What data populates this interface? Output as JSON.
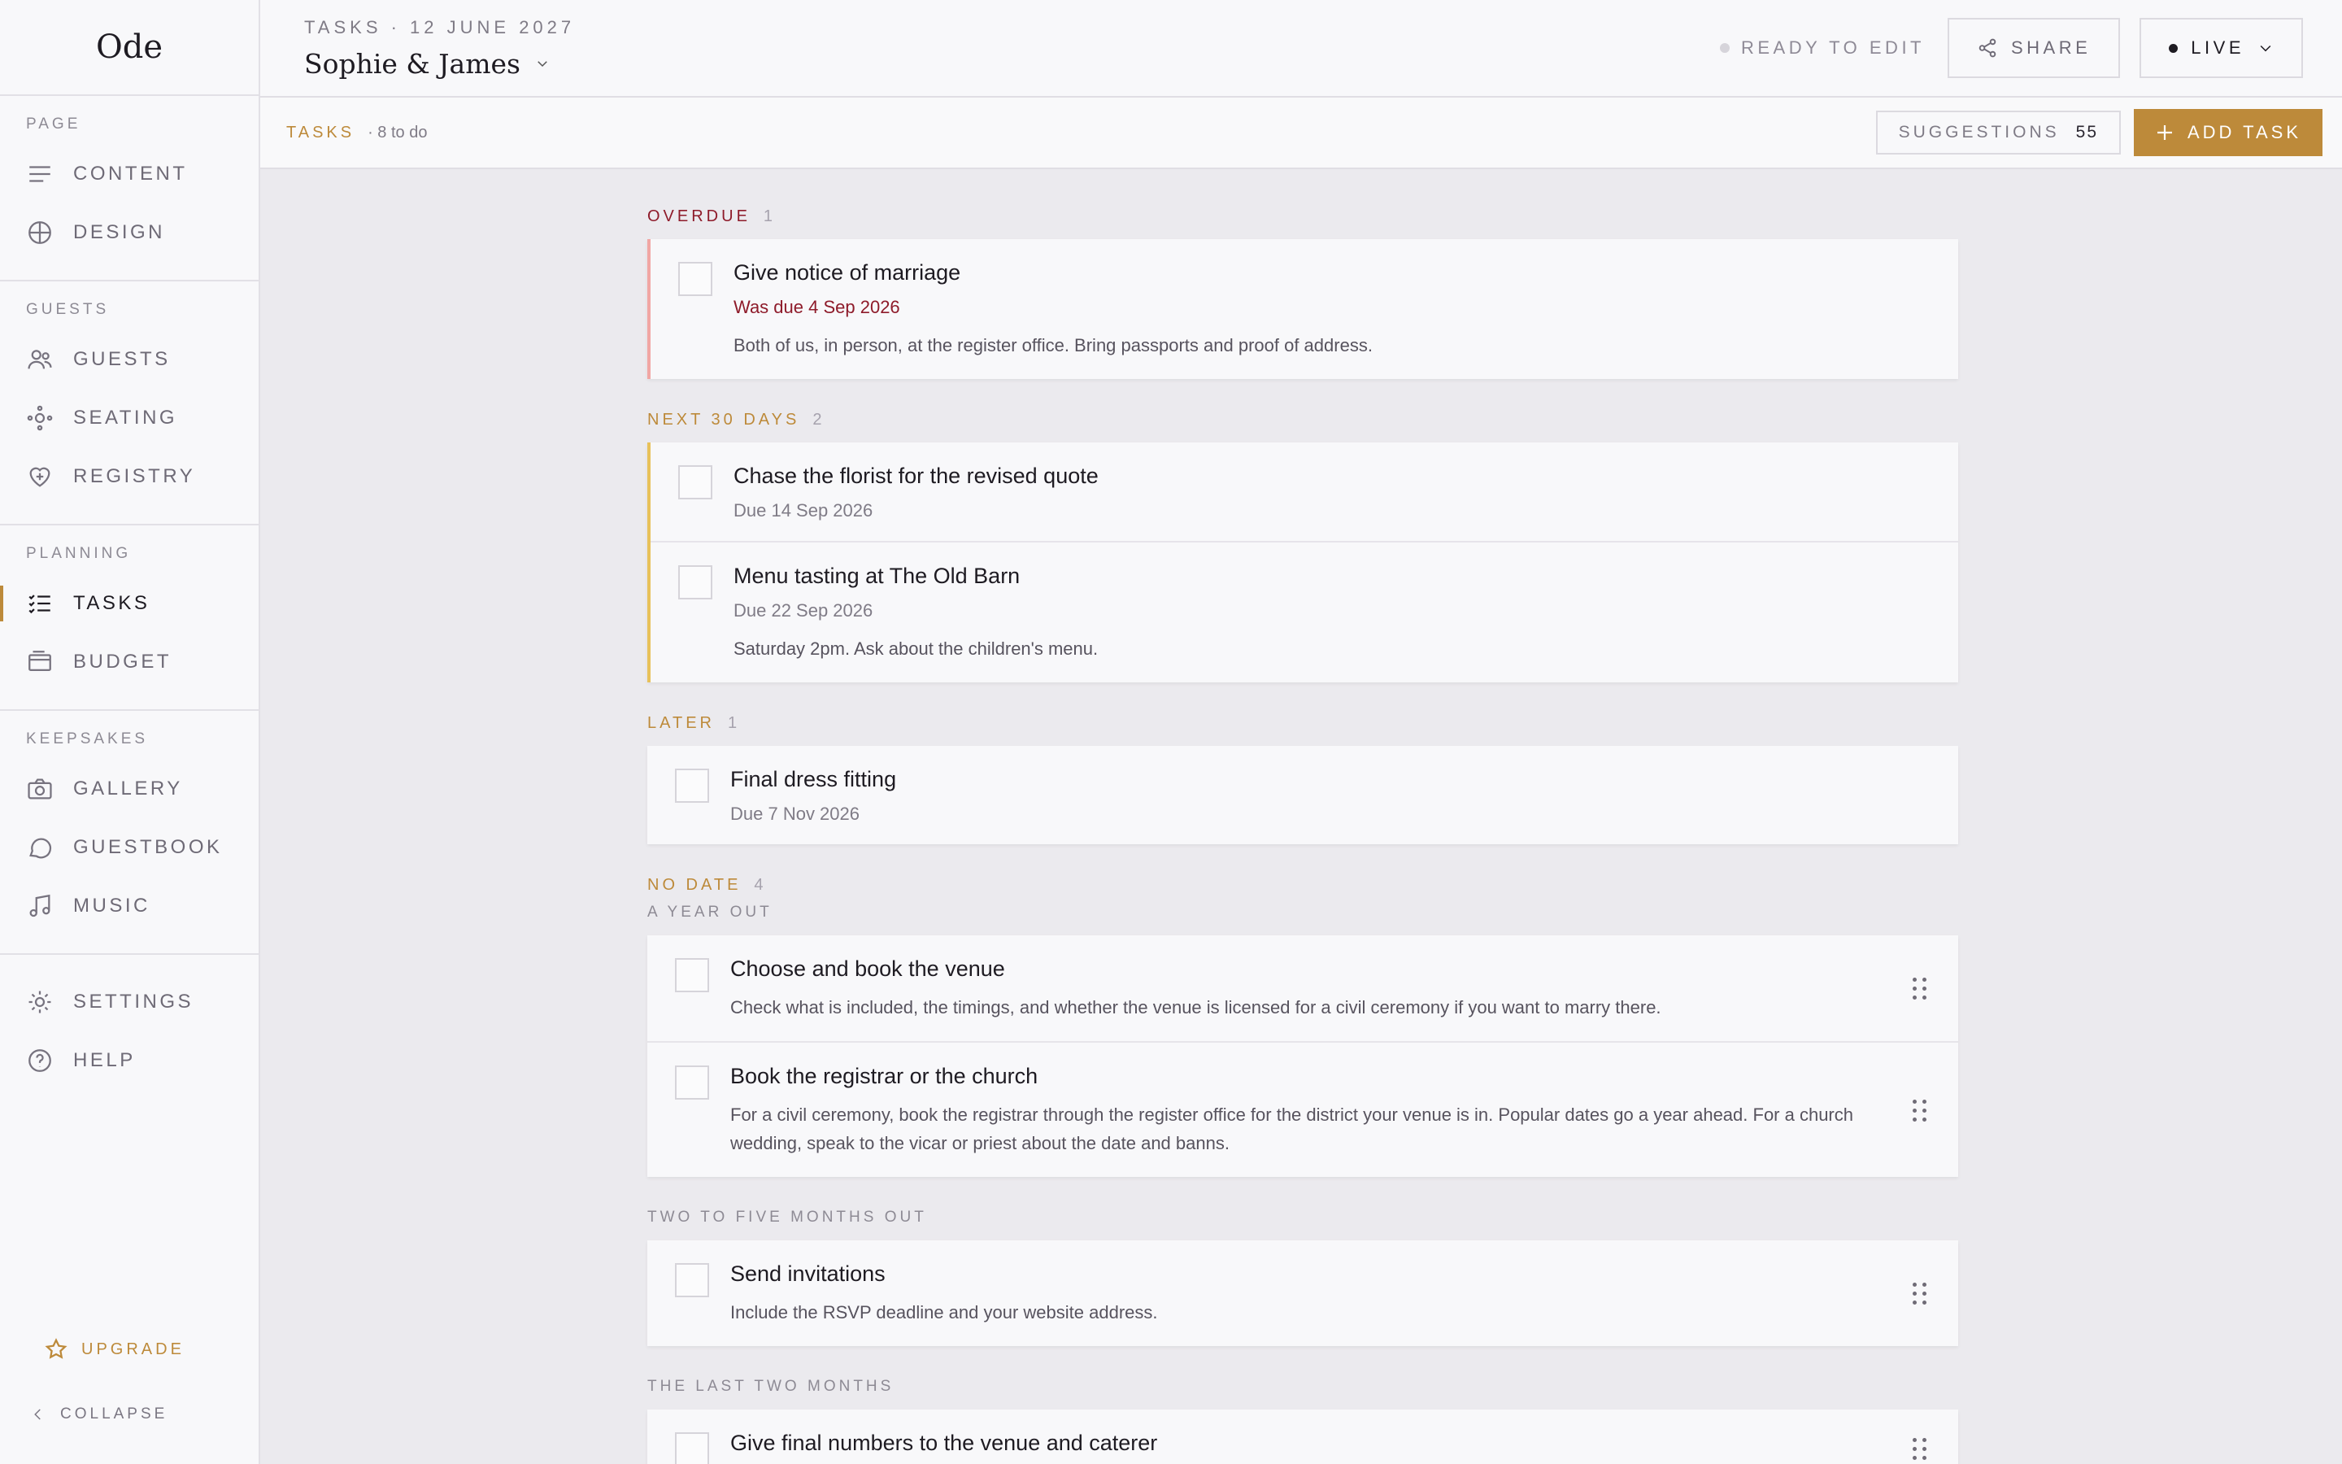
{
  "sidebar": {
    "logo": "Ode",
    "groups": [
      {
        "label": "Page",
        "items": [
          {
            "label": "Content"
          },
          {
            "label": "Design"
          }
        ]
      },
      {
        "label": "Guests",
        "items": [
          {
            "label": "Guests"
          },
          {
            "label": "Seating"
          },
          {
            "label": "Registry"
          }
        ]
      },
      {
        "label": "Planning",
        "items": [
          {
            "label": "Tasks"
          },
          {
            "label": "Budget"
          }
        ]
      },
      {
        "label": "Keepsakes",
        "items": [
          {
            "label": "Gallery"
          },
          {
            "label": "Guestbook"
          },
          {
            "label": "Music"
          }
        ]
      }
    ],
    "settings": "Settings",
    "help": "Help",
    "upgrade": "Upgrade",
    "collapse": "Collapse"
  },
  "header": {
    "breadcrumb": "TASKS · 12 JUNE 2027",
    "site_name": "Sophie & James",
    "status": "READY TO EDIT",
    "share": "SHARE",
    "live": "LIVE"
  },
  "subbar": {
    "title": "Tasks",
    "count": "· 8 to do",
    "suggestions_label": "Suggestions",
    "suggestions_count": "55",
    "add_task": "Add task"
  },
  "sections": {
    "overdue": {
      "label": "Overdue",
      "count": "1",
      "tasks": [
        {
          "title": "Give notice of marriage",
          "due": "Was due 4 Sep 2026",
          "note": "Both of us, in person, at the register office. Bring passports and proof of address."
        }
      ]
    },
    "next30": {
      "label": "Next 30 days",
      "count": "2",
      "tasks": [
        {
          "title": "Chase the florist for the revised quote",
          "due": "Due 14 Sep 2026"
        },
        {
          "title": "Menu tasting at The Old Barn",
          "due": "Due 22 Sep 2026",
          "note": "Saturday 2pm. Ask about the children's menu."
        }
      ]
    },
    "later": {
      "label": "Later",
      "count": "1",
      "tasks": [
        {
          "title": "Final dress fitting",
          "due": "Due 7 Nov 2026"
        }
      ]
    },
    "nodate": {
      "label": "No date",
      "count": "4",
      "year_out": {
        "label": "A year out",
        "tasks": [
          {
            "title": "Choose and book the venue",
            "note": "Check what is included, the timings, and whether the venue is licensed for a civil ceremony if you want to marry there."
          },
          {
            "title": "Book the registrar or the church",
            "note": "For a civil ceremony, book the registrar through the register office for the district your venue is in. Popular dates go a year ahead. For a church wedding, speak to the vicar or priest about the date and banns."
          }
        ]
      },
      "two_five": {
        "label": "Two to five months out",
        "tasks": [
          {
            "title": "Send invitations",
            "note": "Include the RSVP deadline and your website address."
          }
        ]
      },
      "last_two": {
        "label": "The last two months",
        "tasks": [
          {
            "title": "Give final numbers to the venue and caterer"
          }
        ]
      }
    }
  },
  "colors": {
    "accent": "#bd8a3a",
    "overdue": "#8e1b2a",
    "overdue_bar": "#f1a6a4",
    "soon_bar": "#e8c15a"
  }
}
